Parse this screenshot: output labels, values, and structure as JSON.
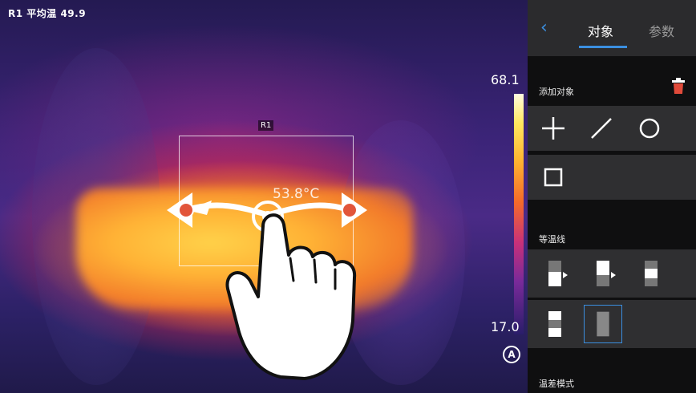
{
  "thermal": {
    "readout": "R1 平均温 49.9",
    "roi_label": "R1",
    "roi_temp": "53.8°C",
    "scale_max": "68.1",
    "scale_min": "17.0",
    "auto_label": "A",
    "palette": [
      "#2a1d6a",
      "#7a2a9a",
      "#c8307a",
      "#f46a2a",
      "#ffb330",
      "#ffe860",
      "#fffbe0"
    ]
  },
  "panel": {
    "back_icon": "back-chevron-icon",
    "tabs": [
      {
        "label": "对象",
        "active": true
      },
      {
        "label": "参数",
        "active": false
      }
    ],
    "add_object": {
      "title": "添加对象",
      "delete_icon": "trash-icon",
      "tools": [
        "crosshair-point-icon",
        "line-icon",
        "circle-icon",
        "rectangle-icon"
      ]
    },
    "isotherm": {
      "title": "等温线",
      "modes": [
        "isotherm-above-icon",
        "isotherm-below-icon",
        "isotherm-interval-icon",
        "isotherm-outside-icon",
        "isotherm-off-icon"
      ],
      "selected": "isotherm-off-icon"
    },
    "temp_diff": {
      "title": "温差模式"
    }
  },
  "colors": {
    "accent": "#3b8fe0",
    "panel_bg": "#0f0f10",
    "row_bg": "#2f2f31",
    "header_bg": "#2b2b2d"
  }
}
